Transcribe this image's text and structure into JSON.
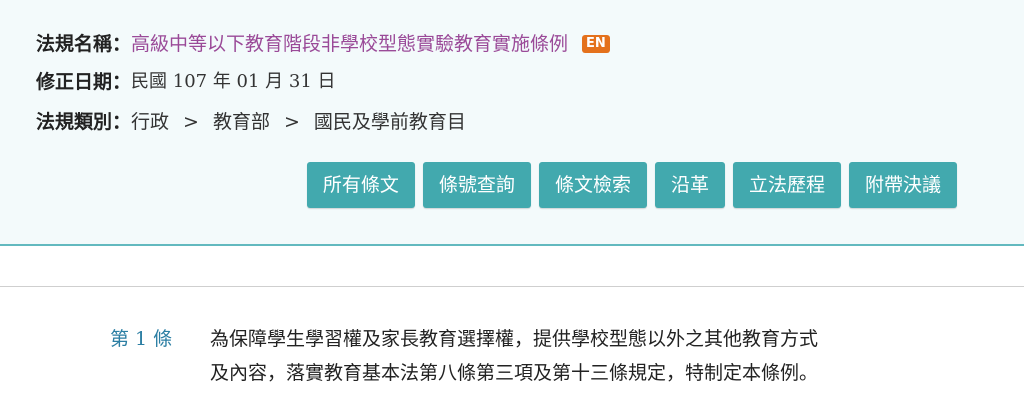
{
  "law": {
    "name_label": "法規名稱",
    "name_value": "高級中等以下教育階段非學校型態實驗教育實施條例",
    "en_badge": "EN",
    "date_label": "修正日期",
    "date_value": "民國 107 年 01 月 31 日",
    "category_label": "法規類別",
    "categories": [
      "行政",
      "教育部",
      "國民及學前教育目"
    ],
    "separator": "：",
    "chevron": ">"
  },
  "buttons": [
    "所有條文",
    "條號查詢",
    "條文檢索",
    "沿革",
    "立法歷程",
    "附帶決議"
  ],
  "article": {
    "number": "第 1 條",
    "lines": [
      "為保障學生學習權及家長教育選擇權，提供學校型態以外之其他教育方式",
      "及內容，落實教育基本法第八條第三項及第十三條規定，特制定本條例。"
    ]
  },
  "colors": {
    "panel_bg": "#f3fafb",
    "accent": "#42a9ae",
    "law_link": "#9a4a98",
    "en_badge": "#e4711c",
    "article_number": "#2b7ea3"
  }
}
